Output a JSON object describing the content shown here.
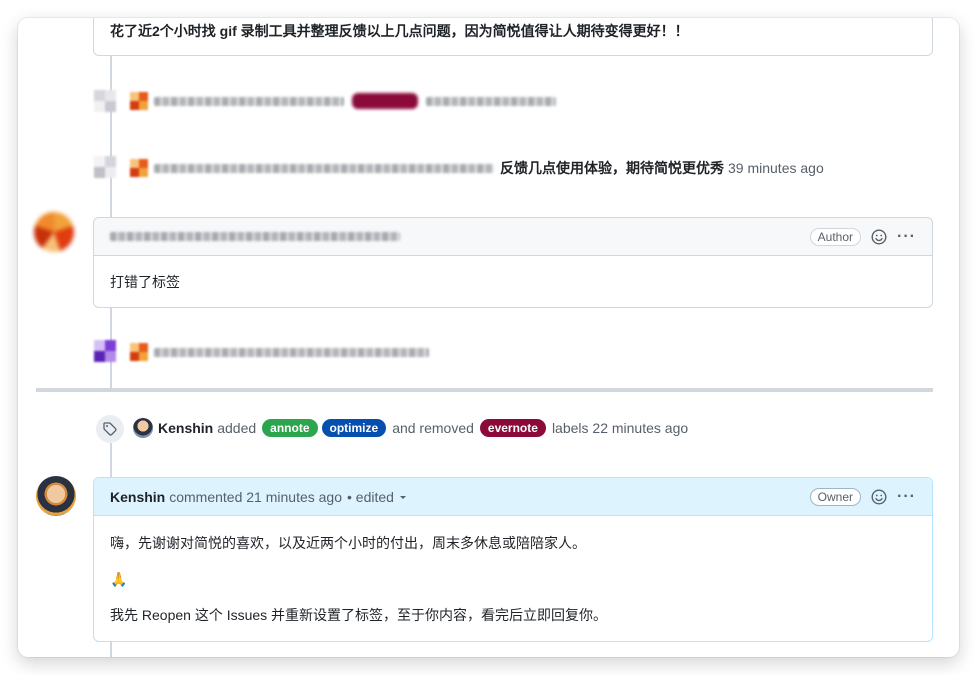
{
  "top_comment": {
    "text": "花了近2个小时找 gif 录制工具并整理反馈以上几点问题，因为简悦值得让人期待变得更好！！"
  },
  "event_title": {
    "suffix": "反馈几点使用体验，期待简悦更优秀",
    "time": "39 minutes ago"
  },
  "author_comment": {
    "badge": "Author",
    "body": "打错了标签"
  },
  "labels_event": {
    "user": "Kenshin",
    "added_text": "added",
    "added_labels": [
      {
        "name": "annote",
        "color": "#2da44e"
      },
      {
        "name": "optimize",
        "color": "#0550ae"
      }
    ],
    "removed_text": "and removed",
    "removed_labels": [
      {
        "name": "evernote",
        "color": "#8b0a3a"
      }
    ],
    "suffix": "labels 22 minutes ago"
  },
  "owner_comment": {
    "user": "Kenshin",
    "meta": "commented 21 minutes ago",
    "edited": "• edited",
    "badge": "Owner",
    "paragraphs": [
      "嗨，先谢谢对简悦的喜欢，以及近两个小时的付出，周末多休息或陪陪家人。",
      "🙏",
      "我先 Reopen 这个 Issues 并重新设置了标签，至于你内容，看完后立即回复你。"
    ]
  },
  "colors": {
    "border": "#d0d7de",
    "header_gray": "#f6f8fa",
    "header_blue": "#ddf4ff"
  }
}
